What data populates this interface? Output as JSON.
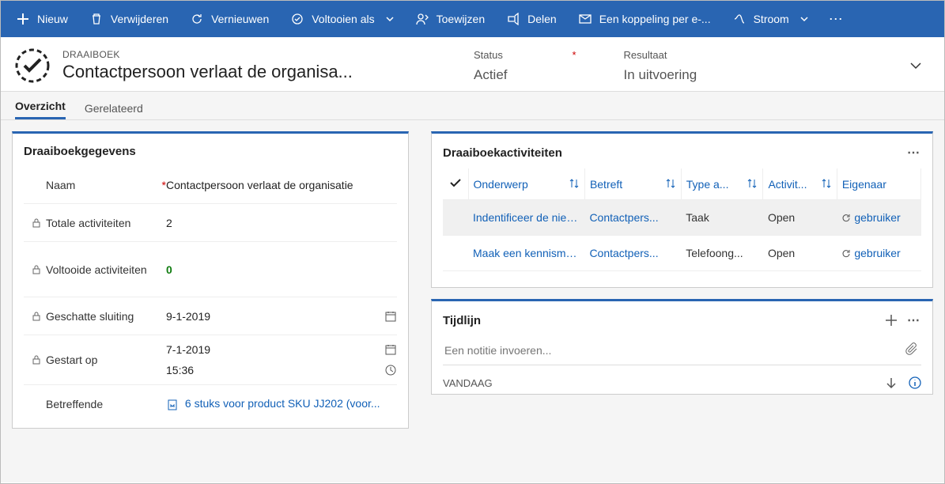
{
  "commandbar": {
    "new": "Nieuw",
    "delete": "Verwijderen",
    "refresh": "Vernieuwen",
    "completeas": "Voltooien als",
    "assign": "Toewijzen",
    "share": "Delen",
    "emaillink": "Een koppeling per e-...",
    "flow": "Stroom"
  },
  "header": {
    "eyebrow": "DRAAIBOEK",
    "title": "Contactpersoon verlaat de organisa...",
    "status_label": "Status",
    "status_value": "Actief",
    "result_label": "Resultaat",
    "result_value": "In uitvoering"
  },
  "tabs": {
    "overview": "Overzicht",
    "related": "Gerelateerd"
  },
  "form": {
    "panel_title": "Draaiboekgegevens",
    "name_label": "Naam",
    "name_value": "Contactpersoon verlaat de organisatie",
    "total_label": "Totale activiteiten",
    "total_value": "2",
    "completed_label": "Voltooide activiteiten",
    "completed_value": "0",
    "estclose_label": "Geschatte sluiting",
    "estclose_value": "9-1-2019",
    "started_label": "Gestart op",
    "started_date": "7-1-2019",
    "started_time": "15:36",
    "regarding_label": "Betreffende",
    "regarding_value": "6 stuks voor product SKU JJ202 (voor..."
  },
  "activities": {
    "panel_title": "Draaiboekactiviteiten",
    "cols": {
      "subject": "Onderwerp",
      "regarding": "Betreft",
      "type": "Type a...",
      "status": "Activit...",
      "owner": "Eigenaar"
    },
    "rows": [
      {
        "subject": "Indentificeer de nieuwe...",
        "regarding": "Contactpers...",
        "type": "Taak",
        "status": "Open",
        "owner": "gebruiker"
      },
      {
        "subject": "Maak een kennismakin...",
        "regarding": "Contactpers...",
        "type": "Telefoong...",
        "status": "Open",
        "owner": "gebruiker"
      }
    ]
  },
  "timeline": {
    "panel_title": "Tijdlijn",
    "placeholder": "Een notitie invoeren...",
    "today": "VANDAAG"
  }
}
